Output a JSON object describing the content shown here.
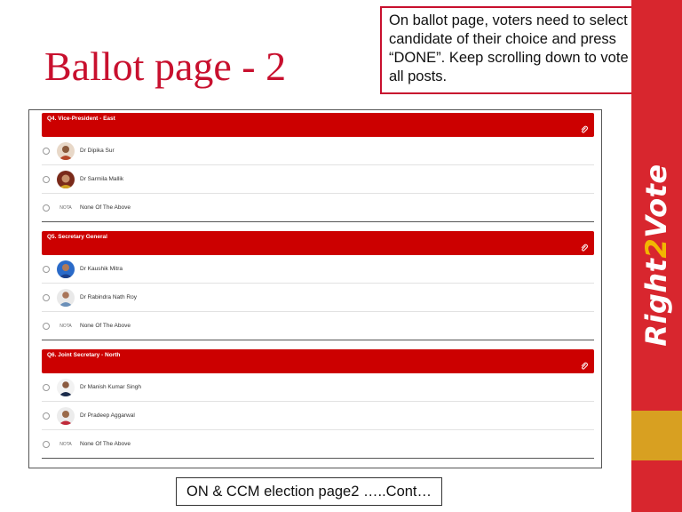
{
  "slide": {
    "title": "Ballot page - 2",
    "callout": "On ballot page, voters need to select the candidate of their choice and press “DONE”. Keep scrolling down to vote for all posts.",
    "footer": "ON & CCM election page2 …..Cont…",
    "brand_prefix": "Right",
    "brand_accent": "2",
    "brand_suffix": "Vote"
  },
  "colors": {
    "header_red": "#cc0000",
    "side_red": "#d8262e",
    "side_gold": "#d8a021",
    "title_red": "#c8102e"
  },
  "ballot": {
    "questions": [
      {
        "title": "Q4.  Vice-President - East",
        "options": [
          {
            "label": "Dr Dipika Sur",
            "icon": "candidate-photo"
          },
          {
            "label": "Dr Sarmila Mallik",
            "icon": "candidate-photo"
          },
          {
            "tag": "NOTA",
            "label": "None Of The Above"
          }
        ]
      },
      {
        "title": "Q5.  Secretary General",
        "options": [
          {
            "label": "Dr Kaushik Mitra",
            "icon": "candidate-photo"
          },
          {
            "label": "Dr Rabindra Nath Roy",
            "icon": "candidate-photo"
          },
          {
            "tag": "NOTA",
            "label": "None Of The Above"
          }
        ]
      },
      {
        "title": "Q6.  Joint Secretary - North",
        "options": [
          {
            "label": "Dr Manish Kumar Singh",
            "icon": "candidate-photo"
          },
          {
            "label": "Dr Pradeep Aggarwal",
            "icon": "candidate-photo"
          },
          {
            "tag": "NOTA",
            "label": "None Of The Above"
          }
        ]
      }
    ]
  }
}
